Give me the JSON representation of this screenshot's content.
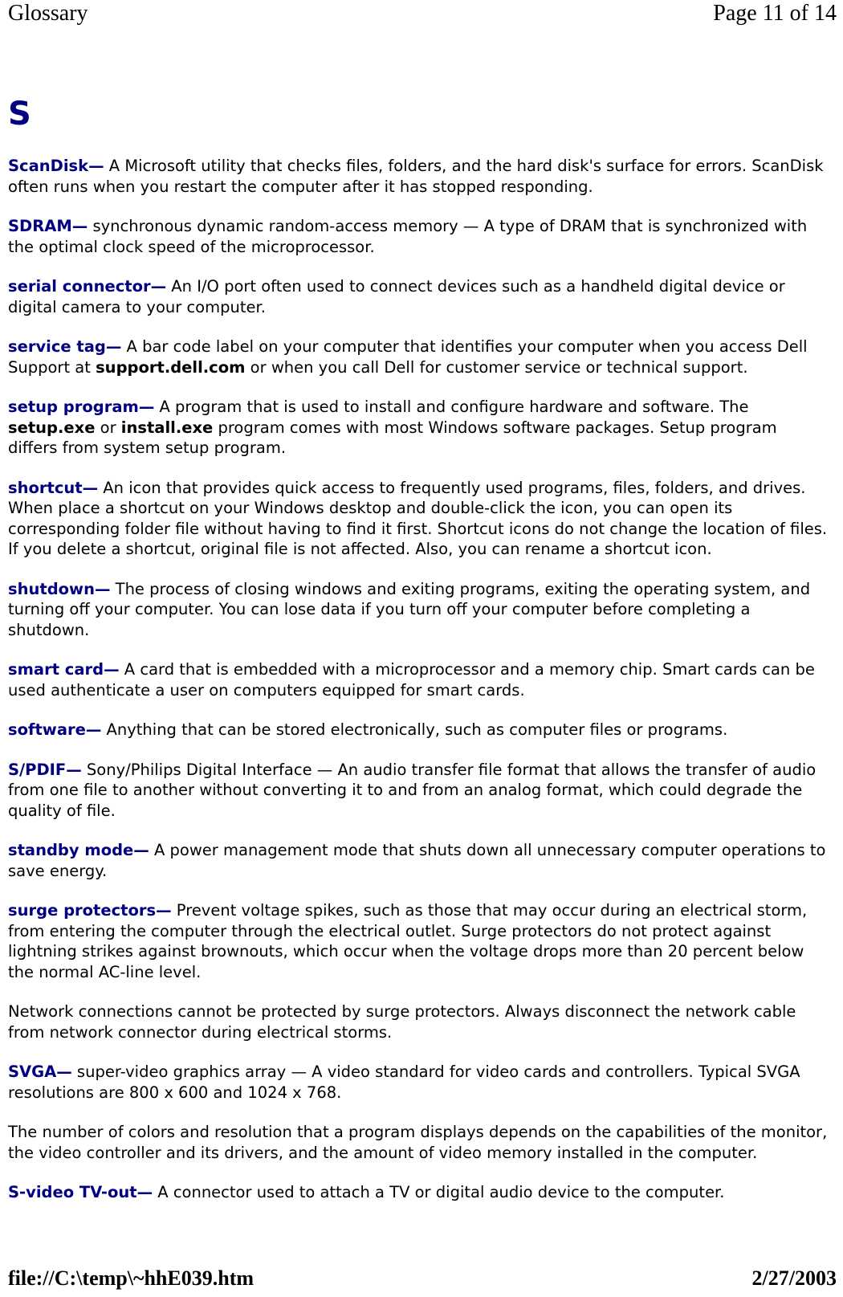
{
  "header": {
    "left": "Glossary",
    "right": "Page 11 of 14"
  },
  "footer": {
    "left": "file://C:\\temp\\~hhE039.htm",
    "right": "2/27/2003"
  },
  "content": {
    "letter_heading": "S",
    "em_dash": "—",
    "entries": [
      {
        "term": "ScanDisk",
        "body_1": " A Microsoft utility that checks files, folders, and the hard disk's surface for errors. ScanDisk often runs when you restart the computer after it has stopped responding."
      },
      {
        "term": "SDRAM",
        "body_1": " synchronous dynamic random-access memory — A type of DRAM that is synchronized with the optimal clock speed of the microprocessor."
      },
      {
        "term": "serial connector",
        "body_1": " An I/O port often used to connect devices such as a handheld digital device or digital camera to your computer."
      },
      {
        "term": "service tag",
        "body_1": " A bar code label on your computer that identifies your computer when you access Dell Support at ",
        "emph_1": "support.dell.com",
        "body_2": " or when you call Dell for customer service or technical support."
      },
      {
        "term": "setup program",
        "body_1": " A program that is used to install and configure hardware and software. The ",
        "emph_1": "setup.exe",
        "body_2": " or ",
        "emph_2": "install.exe",
        "body_3": " program comes with most Windows software packages. Setup program differs from system setup program."
      },
      {
        "term": "shortcut",
        "body_1": " An icon that provides quick access to frequently used programs, files, folders, and drives. When place a shortcut on your Windows desktop and double-click the icon, you can open its corresponding folder file without having to find it first. Shortcut icons do not change the location of files. If you delete a shortcut, original file is not affected. Also, you can rename a shortcut icon."
      },
      {
        "term": "shutdown",
        "body_1": " The process of closing windows and exiting programs, exiting the operating system, and turning off your computer. You can lose data if you turn off your computer before completing a shutdown."
      },
      {
        "term": "smart card",
        "body_1": " A card that is embedded with a microprocessor and a memory chip. Smart cards can be used authenticate a user on computers equipped for smart cards."
      },
      {
        "term": "software",
        "body_1": " Anything that can be stored electronically, such as computer files or programs."
      },
      {
        "term": "S/PDIF",
        "body_1": " Sony/Philips Digital Interface — An audio transfer file format that allows the transfer of audio from one file to another without converting it to and from an analog format, which could degrade the quality of file."
      },
      {
        "term": "standby mode",
        "body_1": " A power management mode that shuts down all unnecessary computer operations to save energy."
      },
      {
        "term": "surge protectors",
        "body_1": " Prevent voltage spikes, such as those that may occur during an electrical storm, from entering the computer through the electrical outlet. Surge protectors do not protect against lightning strikes against brownouts, which occur when the voltage drops more than 20 percent below the normal AC-line level."
      }
    ],
    "note_paragraph_1": "Network connections cannot be protected by surge protectors. Always disconnect the network cable from network connector during electrical storms.",
    "entries_2": [
      {
        "term": "SVGA",
        "body_1": " super-video graphics array — A video standard for video cards and controllers. Typical SVGA resolutions are 800 x 600 and 1024 x 768."
      }
    ],
    "note_paragraph_2": "The number of colors and resolution that a program displays depends on the capabilities of the monitor, the video controller and its drivers, and the amount of video memory installed in the computer.",
    "entries_3": [
      {
        "term": "S-video TV-out",
        "body_1": " A connector used to attach a TV or digital audio device to the computer."
      }
    ]
  },
  "colors": {
    "term_navy": "#000080",
    "body_black": "#000000",
    "page_background": "#ffffff"
  }
}
